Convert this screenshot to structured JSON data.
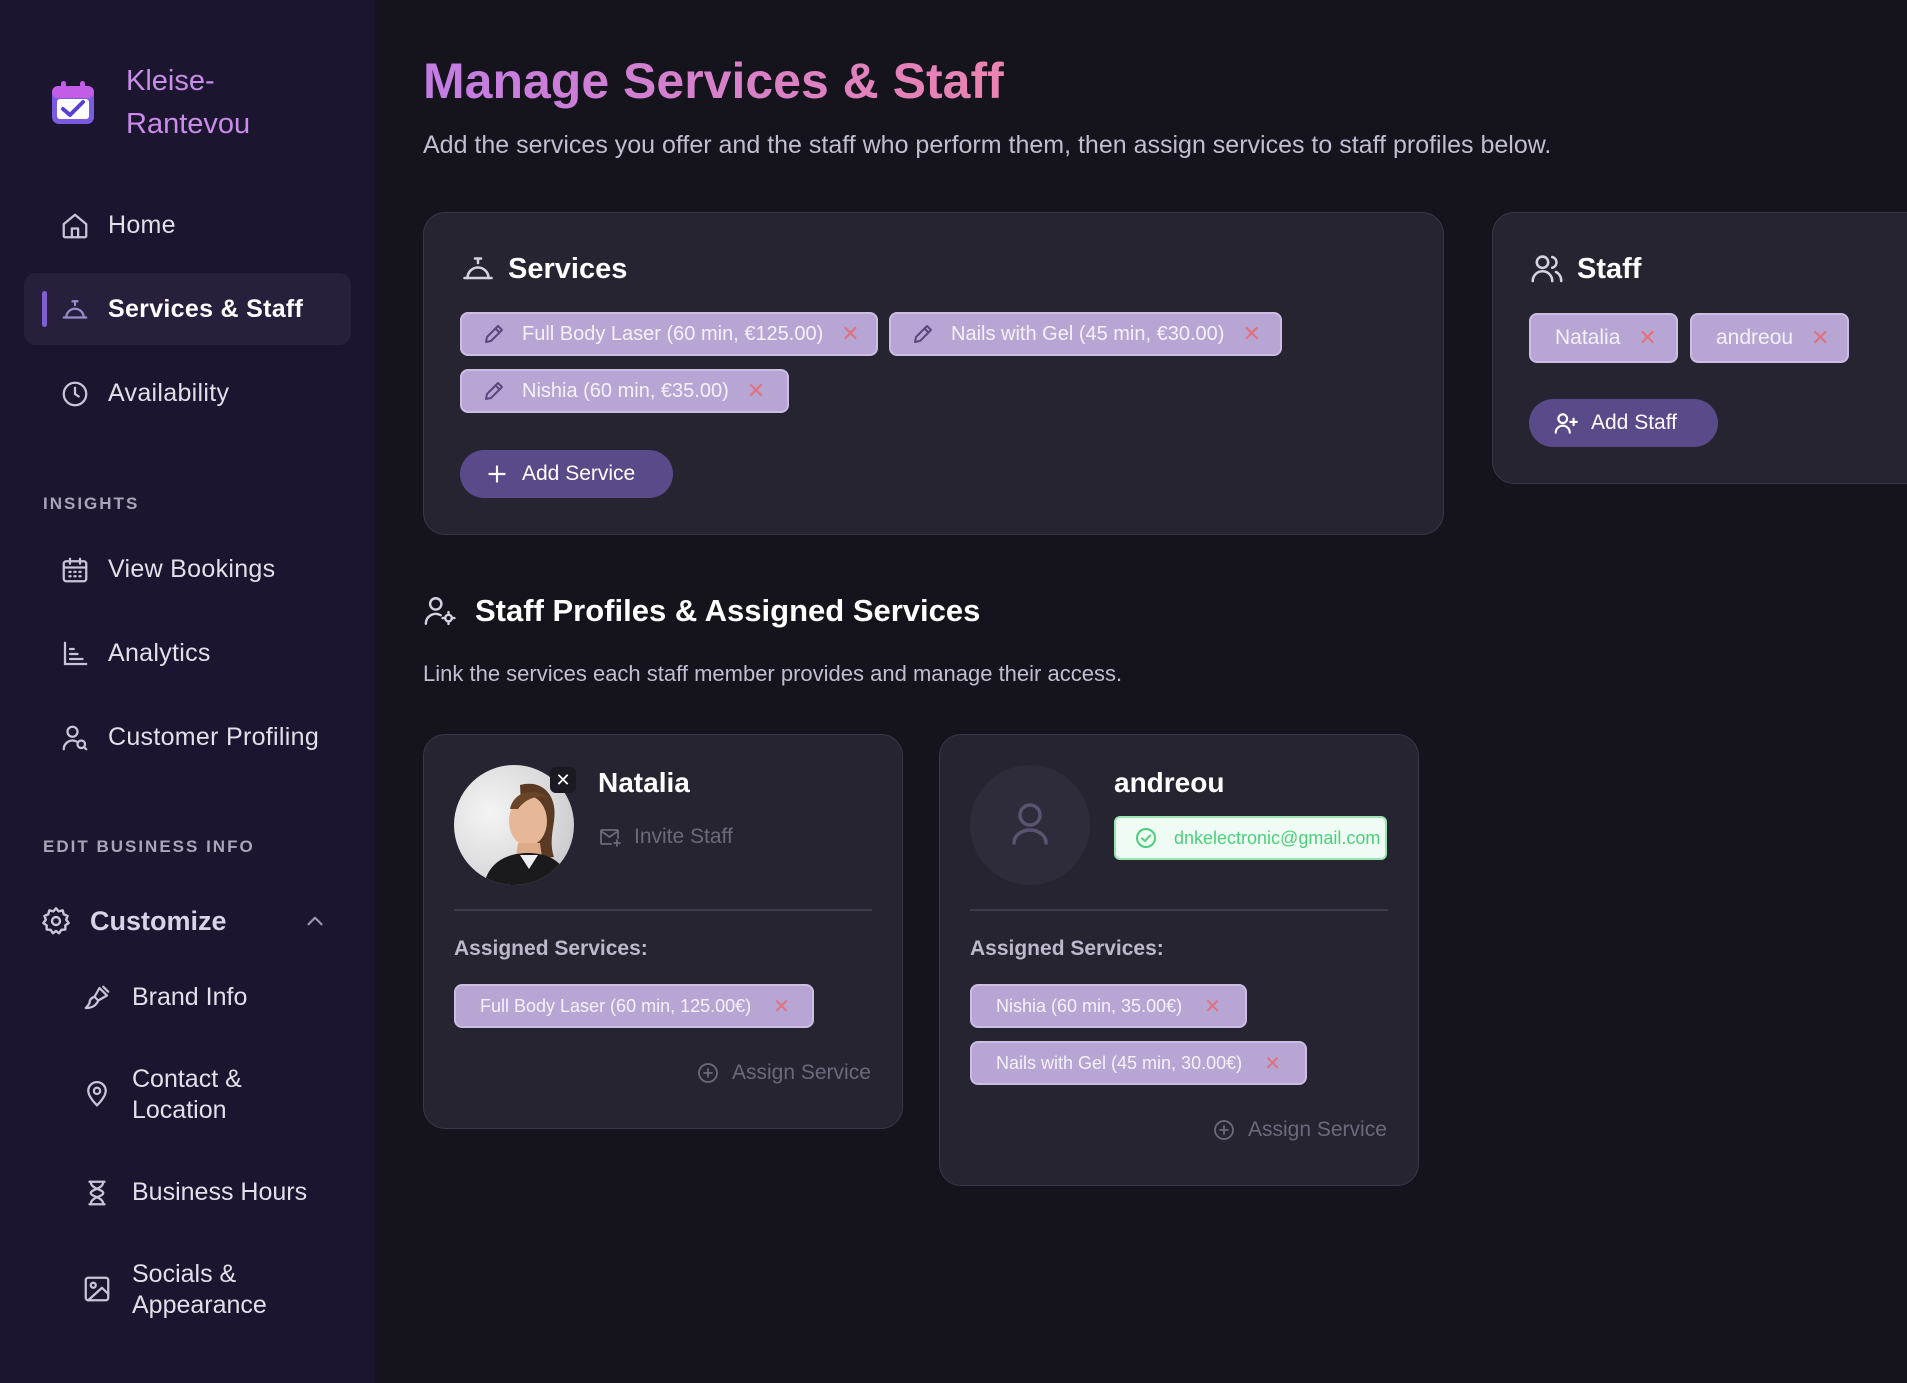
{
  "brand": {
    "name": "Kleise-Rantevou",
    "icon": "calendar-check-icon",
    "color": "#c98ce8"
  },
  "nav": {
    "home": "Home",
    "services_staff": "Services & Staff",
    "availability": "Availability"
  },
  "insights": {
    "title": "INSIGHTS",
    "view_bookings": "View Bookings",
    "analytics": "Analytics",
    "customer_profiling": "Customer Profiling"
  },
  "edit_business": {
    "title": "EDIT BUSINESS INFO",
    "customize": "Customize",
    "brand_info": "Brand Info",
    "contact_location": "Contact & Location",
    "business_hours": "Business Hours",
    "socials_appearance": "Socials & Appearance"
  },
  "page": {
    "title": "Manage Services & Staff",
    "subtitle": "Add the services you offer and the staff who perform them, then assign services to staff profiles below."
  },
  "services": {
    "title": "Services",
    "items": [
      "Full Body Laser (60 min, €125.00)",
      "Nails with Gel (45 min, €30.00)",
      "Nishia (60 min, €35.00)"
    ],
    "add_label": "Add Service"
  },
  "staff": {
    "title": "Staff",
    "items": [
      "Natalia",
      "andreou"
    ],
    "add_label": "Add Staff"
  },
  "profiles": {
    "title": "Staff Profiles & Assigned Services",
    "subtitle": "Link the services each staff member provides and manage their access.",
    "assigned_label": "Assigned Services:",
    "assign_label": "Assign Service",
    "cards": [
      {
        "name": "Natalia",
        "invite_label": "Invite Staff",
        "services": [
          "Full Body Laser (60 min, 125.00€)"
        ]
      },
      {
        "name": "andreou",
        "email": "dnkelectronic@gmail.com",
        "services": [
          "Nishia (60 min, 35.00€)",
          "Nails with Gel (45 min, 30.00€)"
        ]
      }
    ]
  },
  "colors": {
    "background": "#15131c",
    "sidebar": "#1c1530",
    "card": "#262431",
    "chip": "#b7a5d3",
    "accent_button": "#5b4a8a",
    "remove": "#e0727f",
    "success": "#4ccf7d"
  }
}
